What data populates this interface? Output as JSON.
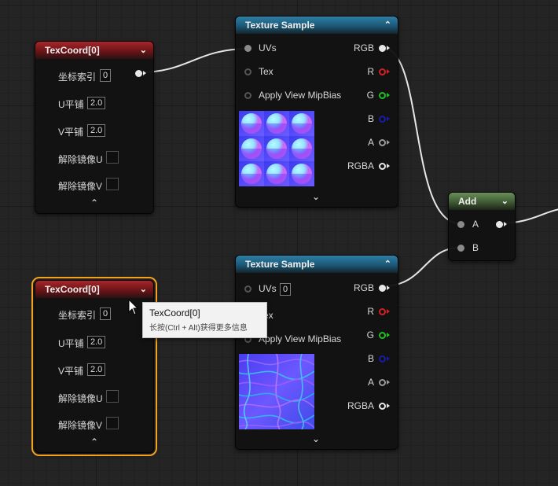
{
  "texcoord_node": {
    "title": "TexCoord[0]",
    "coord_index_label": "坐标索引",
    "coord_index_value": "0",
    "u_tile_label": "U平铺",
    "u_tile_value": "2.0",
    "v_tile_label": "V平铺",
    "v_tile_value": "2.0",
    "unmirror_u_label": "解除镜像U",
    "unmirror_v_label": "解除镜像V"
  },
  "texture_sample_node": {
    "title": "Texture Sample",
    "uvs_label": "UVs",
    "uvs_value": "0",
    "tex_label": "Tex",
    "mipbias_label": "Apply View MipBias",
    "out_rgb": "RGB",
    "out_r": "R",
    "out_g": "G",
    "out_b": "B",
    "out_a": "A",
    "out_rgba": "RGBA"
  },
  "add_node": {
    "title": "Add",
    "in_a": "A",
    "in_b": "B"
  },
  "tooltip": {
    "title": "TexCoord[0]",
    "hint": "长按(Ctrl + Alt)获得更多信息"
  },
  "colors": {
    "selection": "#f2a120",
    "pin_r": "#d62020",
    "pin_g": "#20c020",
    "pin_b": "#1a1aa8",
    "pin_a": "#9a9a9a"
  }
}
